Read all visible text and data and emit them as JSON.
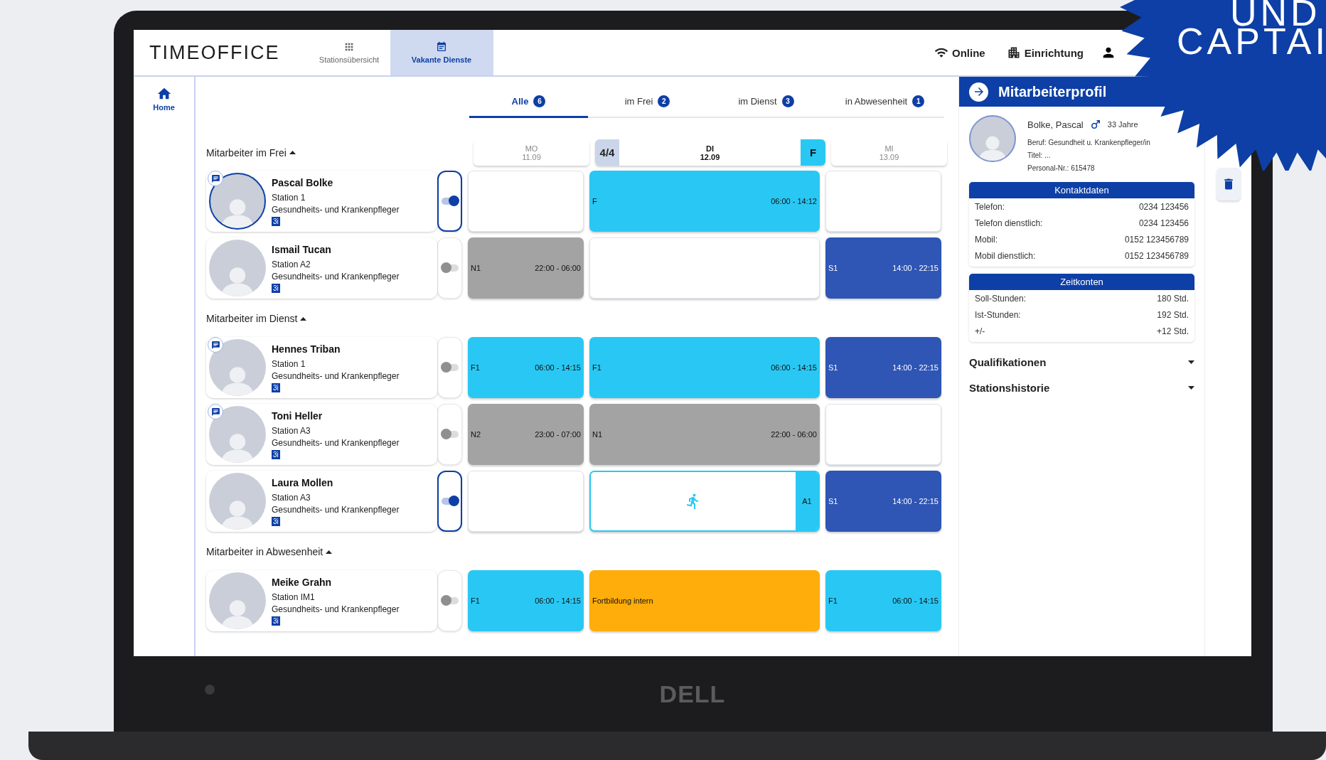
{
  "brand": "TIMEOFFICE",
  "nav": [
    {
      "label": "Stationsübersicht",
      "selected": false
    },
    {
      "label": "Vakante Dienste",
      "selected": true
    }
  ],
  "status": [
    {
      "label": "Online"
    },
    {
      "label": "Einrichtung"
    }
  ],
  "sidebar": {
    "items": [
      {
        "label": "Home",
        "selected": true
      }
    ]
  },
  "tabs": [
    {
      "label": "Alle",
      "count": "6",
      "selected": true
    },
    {
      "label": "im Frei",
      "count": "2",
      "selected": false
    },
    {
      "label": "im Dienst",
      "count": "3",
      "selected": false
    },
    {
      "label": "in Abwesenheit",
      "count": "1",
      "selected": false
    }
  ],
  "days": [
    {
      "weekday": "MO",
      "date": "11.09",
      "selected": false
    },
    {
      "weekday": "DI",
      "date": "12.09",
      "selected": true,
      "count": "4/4",
      "shift_badge": "F"
    },
    {
      "weekday": "MI",
      "date": "13.09",
      "selected": false
    }
  ],
  "groups": [
    {
      "title": "Mitarbeiter im Frei",
      "expanded": true,
      "employees": [
        {
          "name": "Pascal Bolke",
          "station": "Station 1",
          "role": "Gesundheits- und Krankenpfleger",
          "badge": "3i",
          "has_note": true,
          "selected": true,
          "toggle_on": true,
          "shifts": [
            {
              "kind": "empty"
            },
            {
              "kind": "shift",
              "code": "F",
              "time": "06:00 - 14:12",
              "color": "#29c8f4"
            },
            {
              "kind": "empty"
            }
          ]
        },
        {
          "name": "Ismail Tucan",
          "station": "Station A2",
          "role": "Gesundheits- und Krankenpfleger",
          "badge": "3i",
          "has_note": false,
          "selected": false,
          "toggle_on": false,
          "shifts": [
            {
              "kind": "shift",
              "code": "N1",
              "time": "22:00 - 06:00",
              "color": "#a3a3a3"
            },
            {
              "kind": "empty"
            },
            {
              "kind": "shift",
              "code": "S1",
              "time": "14:00 - 22:15",
              "color": "#2f55b5"
            }
          ]
        }
      ]
    },
    {
      "title": "Mitarbeiter im Dienst",
      "expanded": true,
      "employees": [
        {
          "name": "Hennes Triban",
          "station": "Station 1",
          "role": "Gesundheits- und Krankenpfleger",
          "badge": "3i",
          "has_note": true,
          "selected": false,
          "toggle_on": false,
          "shifts": [
            {
              "kind": "shift",
              "code": "F1",
              "time": "06:00 - 14:15",
              "color": "#29c8f4"
            },
            {
              "kind": "shift",
              "code": "F1",
              "time": "06:00 - 14:15",
              "color": "#29c8f4"
            },
            {
              "kind": "shift",
              "code": "S1",
              "time": "14:00 - 22:15",
              "color": "#2f55b5"
            }
          ]
        },
        {
          "name": "Toni Heller",
          "station": "Station A3",
          "role": "Gesundheits- und Krankenpfleger",
          "badge": "3i",
          "has_note": true,
          "selected": false,
          "toggle_on": false,
          "shifts": [
            {
              "kind": "shift",
              "code": "N2",
              "time": "23:00 - 07:00",
              "color": "#a3a3a3"
            },
            {
              "kind": "shift",
              "code": "N1",
              "time": "22:00 - 06:00",
              "color": "#a3a3a3"
            },
            {
              "kind": "empty"
            }
          ]
        },
        {
          "name": "Laura Mollen",
          "station": "Station A3",
          "role": "Gesundheits- und Krankenpfleger",
          "badge": "3i",
          "has_note": false,
          "selected": false,
          "toggle_on": true,
          "shifts": [
            {
              "kind": "empty"
            },
            {
              "kind": "vacancy",
              "code": "A1",
              "color": "#29c8f4"
            },
            {
              "kind": "shift",
              "code": "S1",
              "time": "14:00 - 22:15",
              "color": "#2f55b5"
            }
          ]
        }
      ]
    },
    {
      "title": "Mitarbeiter in Abwesenheit",
      "expanded": true,
      "employees": [
        {
          "name": "Meike Grahn",
          "station": "Station IM1",
          "role": "Gesundheits- und Krankenpfleger",
          "badge": "3i",
          "has_note": false,
          "selected": false,
          "toggle_on": false,
          "shifts": [
            {
              "kind": "shift",
              "code": "F1",
              "time": "06:00 - 14:15",
              "color": "#29c8f4"
            },
            {
              "kind": "absence",
              "label": "Fortbildung intern",
              "color": "#ffad0a"
            },
            {
              "kind": "shift",
              "code": "F1",
              "time": "06:00 - 14:15",
              "color": "#29c8f4"
            }
          ]
        }
      ]
    }
  ],
  "profile": {
    "title": "Mitarbeiterprofil",
    "name": "Bolke, Pascal",
    "age": "33 Jahre",
    "details": [
      "Beruf: Gesundheit u. Krankenpfleger/in",
      "Titel: ...",
      "Personal-Nr.: 615478"
    ],
    "sections": [
      {
        "title": "Kontaktdaten",
        "rows": [
          {
            "label": "Telefon:",
            "value": "0234 123456"
          },
          {
            "label": "Telefon dienstlich:",
            "value": "0234 123456"
          },
          {
            "label": "Mobil:",
            "value": "0152 123456789"
          },
          {
            "label": "Mobil dienstlich:",
            "value": "0152 123456789"
          }
        ]
      },
      {
        "title": "Zeitkonten",
        "rows": [
          {
            "label": "Soll-Stunden:",
            "value": "180 Std."
          },
          {
            "label": "Ist-Stunden:",
            "value": "192 Std."
          },
          {
            "label": "+/-",
            "value": "+12 Std."
          }
        ]
      }
    ],
    "accordions": [
      {
        "title": "Qualifikationen",
        "expanded": false
      },
      {
        "title": "Stationshistorie",
        "expanded": false
      }
    ]
  },
  "laptop": {
    "logo": "DELL"
  },
  "badge": {
    "lines": [
      "UND",
      "CAPTAI"
    ]
  }
}
